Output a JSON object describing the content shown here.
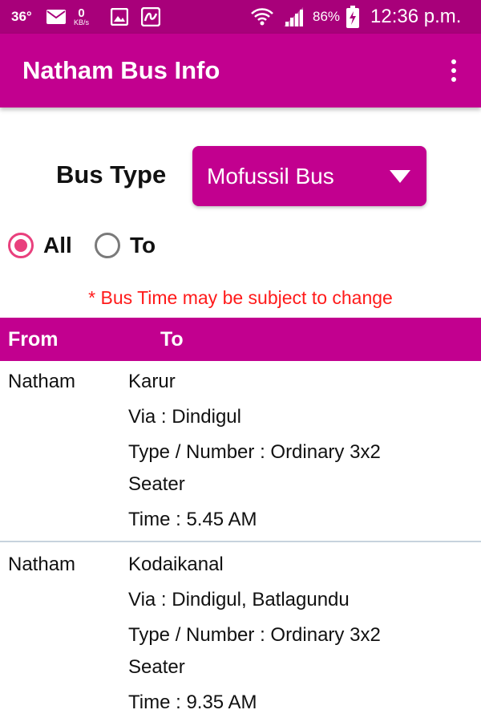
{
  "status_bar": {
    "temperature": "36°",
    "net_speed": "0",
    "net_unit": "KB/s",
    "battery": "86%",
    "clock": "12:36 p.m."
  },
  "app_bar": {
    "title": "Natham Bus Info"
  },
  "filter": {
    "bus_type_label": "Bus Type",
    "bus_type_value": "Mofussil Bus",
    "radio_all": "All",
    "radio_to": "To",
    "selected": "All"
  },
  "notice": "* Bus Time may be subject to change",
  "table": {
    "headers": {
      "from": "From",
      "to": "To"
    },
    "rows": [
      {
        "from": "Natham",
        "to": "Karur",
        "via": "Via : Dindigul",
        "type": "Type / Number :  Ordinary 3x2 Seater",
        "time": "Time : 5.45 AM"
      },
      {
        "from": "Natham",
        "to": "Kodaikanal",
        "via": "Via : Dindigul, Batlagundu",
        "type": "Type / Number :  Ordinary 3x2 Seater",
        "time": "Time : 9.35 AM"
      }
    ]
  },
  "colors": {
    "status_bar": "#a8007a",
    "primary": "#c2008f",
    "radio_accent": "#e9407d",
    "notice": "#ff1a1a"
  }
}
